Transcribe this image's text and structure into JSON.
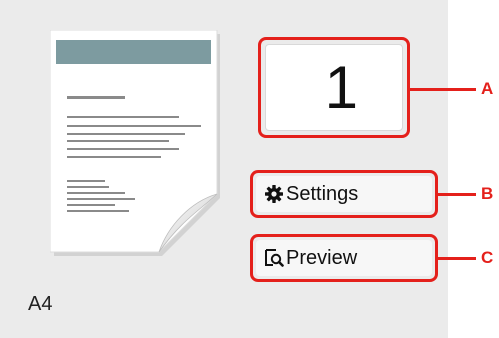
{
  "preview": {
    "paper_size": "A4"
  },
  "copies": {
    "value": "1"
  },
  "buttons": {
    "settings_label": "Settings",
    "preview_label": "Preview"
  },
  "callouts": {
    "a": "A",
    "b": "B",
    "c": "C"
  },
  "colors": {
    "callout": "#e4201b",
    "panel": "#ebebeb"
  },
  "icons": {
    "settings": "gear-icon",
    "preview": "magnifier-page-icon"
  }
}
